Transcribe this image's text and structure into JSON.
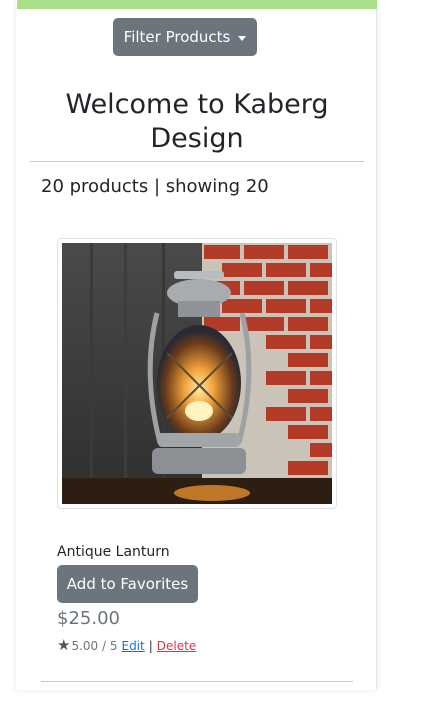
{
  "header": {
    "filter_label": "Filter Products",
    "title": "Welcome to Kaberg Design",
    "count_text": "20 products | showing 20"
  },
  "product": {
    "name": "Antique Lanturn",
    "favorite_label": "Add to Favorites",
    "price": "$25.00",
    "rating": "5.00 / 5",
    "edit_label": "Edit",
    "separator": "|",
    "delete_label": "Delete",
    "image_icon": "lantern-photo"
  },
  "colors": {
    "accent_bar": "#a8e08a",
    "button": "#6c757d",
    "edit_link": "#0d6efd",
    "delete_link": "#dc3545"
  }
}
